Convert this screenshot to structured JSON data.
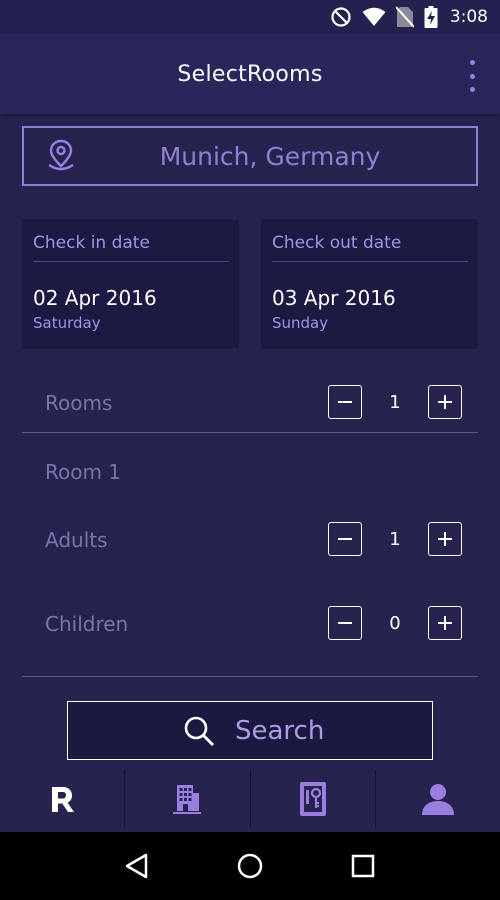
{
  "status_bar": {
    "time": "3:08",
    "icons": [
      "do-not-disturb-icon",
      "wifi-icon",
      "no-sim-icon",
      "battery-charging-icon"
    ]
  },
  "app_bar": {
    "title": "SelectRooms",
    "menu_icon": "more-vert-icon"
  },
  "location": {
    "icon": "location-pin-icon",
    "value": "Munich, Germany"
  },
  "check_in": {
    "label": "Check in date",
    "date": "02 Apr 2016",
    "day": "Saturday"
  },
  "check_out": {
    "label": "Check out date",
    "date": "03 Apr 2016",
    "day": "Sunday"
  },
  "rooms": {
    "label": "Rooms",
    "value": "1"
  },
  "room_1": {
    "heading": "Room 1",
    "adults": {
      "label": "Adults",
      "value": "1"
    },
    "children": {
      "label": "Children",
      "value": "0"
    }
  },
  "search": {
    "label": "Search",
    "icon": "search-icon"
  },
  "bottom_nav": {
    "items": [
      {
        "icon": "brand-r-icon",
        "text": "R",
        "active": true
      },
      {
        "icon": "hotel-building-icon"
      },
      {
        "icon": "room-key-icon"
      },
      {
        "icon": "profile-icon"
      }
    ]
  },
  "system_nav": [
    "back-icon",
    "home-icon",
    "recents-icon"
  ],
  "colors": {
    "background": "#26244f",
    "card": "#1c1a42",
    "accent": "#9b7fe0",
    "label": "#a194e6",
    "muted": "#7a74a8"
  }
}
